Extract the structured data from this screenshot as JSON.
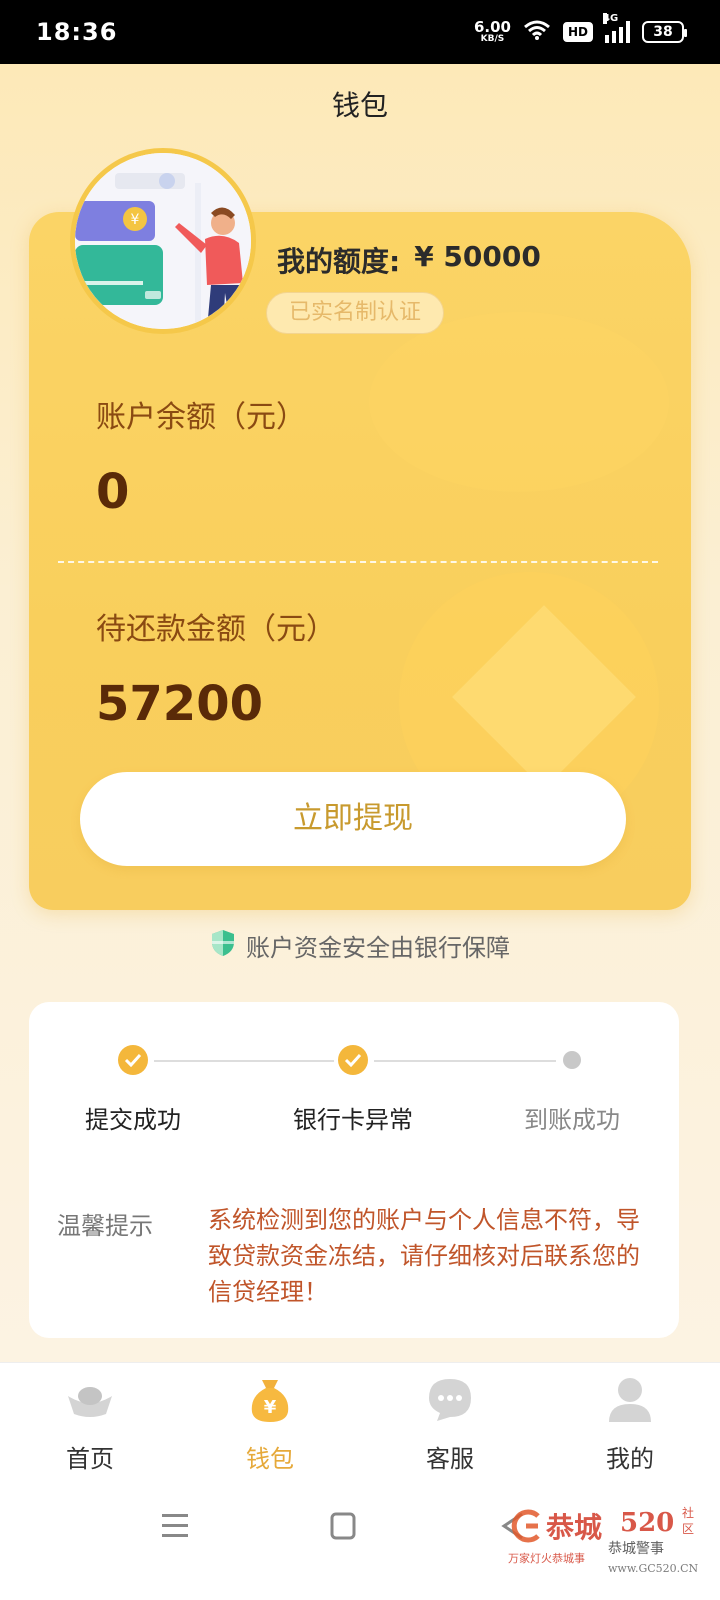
{
  "status_bar": {
    "time": "18:36",
    "net_speed_value": "6.00",
    "net_speed_unit": "KB/S",
    "hd": "HD",
    "signal_type": "4G",
    "battery": "38"
  },
  "header": {
    "title": "钱包"
  },
  "wallet": {
    "quota_label": "我的额度:",
    "quota_value": "¥ 50000",
    "verified_badge": "已实名制认证",
    "balance_label": "账户余额（元）",
    "balance_value": "0",
    "due_label": "待还款金额（元）",
    "due_value": "57200",
    "withdraw_button": "立即提现",
    "accent_color": "#f9cf5c"
  },
  "safety_note": "账户资金安全由银行保障",
  "progress": {
    "steps": [
      {
        "label": "提交成功",
        "status": "done"
      },
      {
        "label": "银行卡异常",
        "status": "done"
      },
      {
        "label": "到账成功",
        "status": "pending"
      }
    ],
    "tip_title": "温馨提示",
    "tip_text": "系统检测到您的账户与个人信息不符，导致贷款资金冻结，请仔细核对后联系您的信贷经理！"
  },
  "bottom_nav": {
    "items": [
      {
        "label": "首页",
        "icon": "ingot-icon",
        "active": false
      },
      {
        "label": "钱包",
        "icon": "money-bag-icon",
        "active": true
      },
      {
        "label": "客服",
        "icon": "chat-bubble-icon",
        "active": false
      },
      {
        "label": "我的",
        "icon": "user-icon",
        "active": false
      }
    ]
  },
  "watermark": {
    "brand": "恭城",
    "number": "520",
    "side1": "社",
    "side2": "区",
    "slogan": "万家灯火恭城事",
    "site": "www.GC520.CN",
    "account": "恭城警事"
  }
}
